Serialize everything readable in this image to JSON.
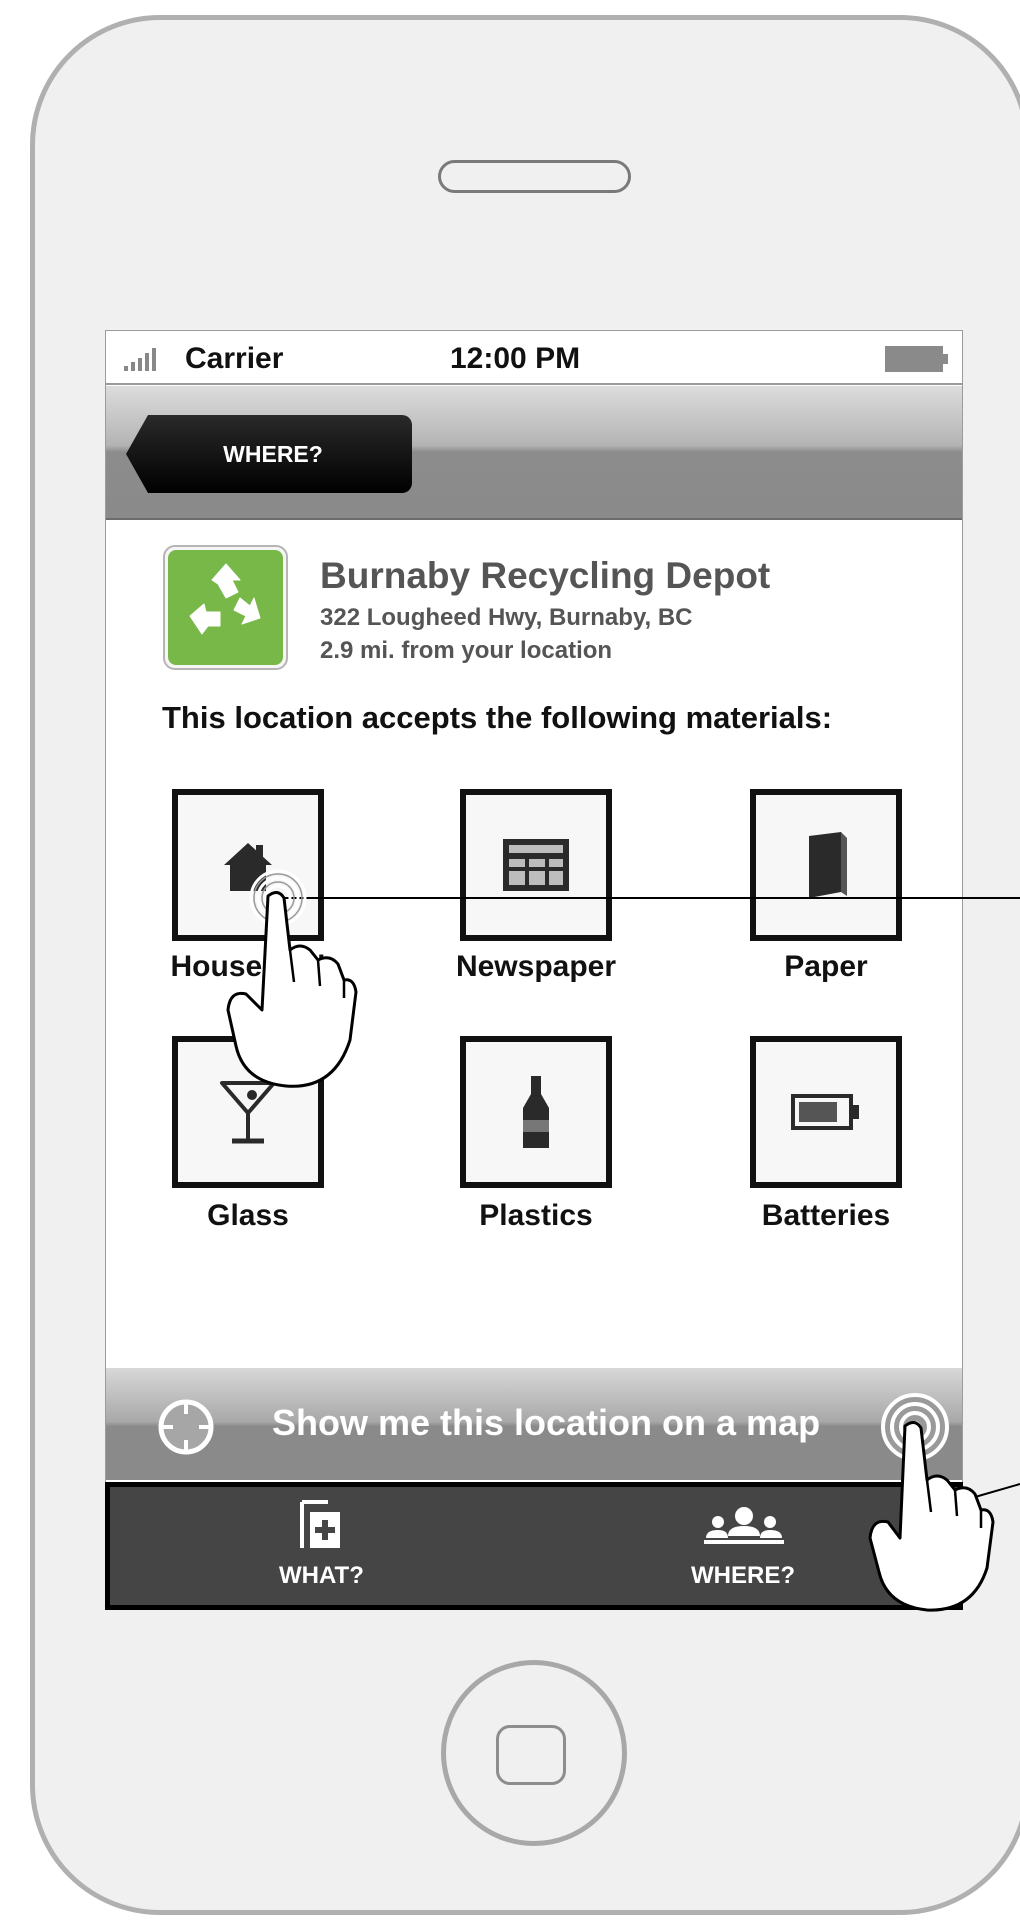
{
  "status_bar": {
    "carrier": "Carrier",
    "time": "12:00 PM"
  },
  "nav": {
    "back_label": "WHERE?"
  },
  "location": {
    "name": "Burnaby Recycling Depot",
    "address": "322 Lougheed Hwy, Burnaby, BC",
    "distance": "2.9 mi. from your location"
  },
  "accepts_heading": "This location accepts the following materials:",
  "materials": [
    {
      "label": "Household",
      "icon": "house-icon"
    },
    {
      "label": "Newspaper",
      "icon": "newspaper-icon"
    },
    {
      "label": "Paper",
      "icon": "book-icon"
    },
    {
      "label": "Glass",
      "icon": "martini-glass-icon"
    },
    {
      "label": "Plastics",
      "icon": "bottle-icon"
    },
    {
      "label": "Batteries",
      "icon": "battery-icon"
    }
  ],
  "map_button": {
    "label": "Show me this location on a map",
    "icon": "crosshair-icon"
  },
  "tabs": [
    {
      "label": "WHAT?",
      "icon": "add-item-icon"
    },
    {
      "label": "WHERE?",
      "icon": "people-icon"
    }
  ],
  "colors": {
    "logo_green": "#78b849",
    "tab_bar": "#454545",
    "nav_gray": "#8a8a8a"
  }
}
